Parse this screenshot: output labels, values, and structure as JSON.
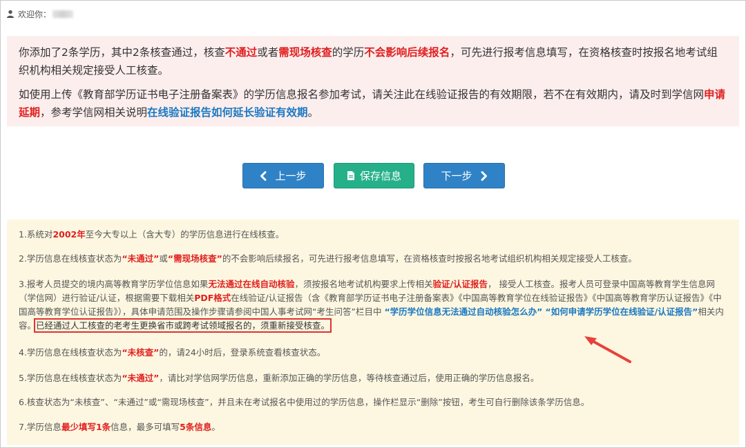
{
  "header": {
    "welcome_label": "欢迎你："
  },
  "notice": {
    "p1": {
      "s1": "你添加了2条学历，其中2条核查通过，核查",
      "s2": "不通过",
      "s3": "或者",
      "s4": "需现场核查",
      "s5": "的学历",
      "s6": "不会影响后续报名",
      "s7": "，可先进行报考信息填写，在资格核查时按报名地考试组织机构相关规定接受人工核查。"
    },
    "p2": {
      "s1": "如使用上传《教育部学历证书电子注册备案表》的学历信息报名参加考试，请关注此在线验证报告的有效期限，若不在有效期内，请及时到学信网",
      "s2": "申请延期",
      "s3": "，参考学信网相关说明",
      "s4": "在线验证报告如何延长验证有效期",
      "s5": "。"
    }
  },
  "buttons": {
    "prev_label": "上一步",
    "save_label": "保存信息",
    "next_label": "下一步"
  },
  "tips": {
    "t1": {
      "s1": "1.系统对",
      "s2": "2002年",
      "s3": "至今大专以上（含大专）的学历信息进行在线核查。"
    },
    "t2": {
      "s1": "2.学历信息在线核查状态为",
      "s2": "“未通过”",
      "s3": "或",
      "s4": "“需现场核查”",
      "s5": "的不会影响后续报名，可先进行报考信息填写，在资格核查时按报名地考试组织机构相关规定接受人工核查。"
    },
    "t3": {
      "s1": "3.报考人员提交的境内高等教育学历学位信息如果",
      "s2": "无法通过在线自动核验",
      "s3": "，须按报名地考试机构要求上传相关",
      "s4": "验证/认证报告",
      "s5": "，  接受人工核查。报考人员可登录中国高等教育学生信息网（学信网）进行验证/认证，根据需要下载相关",
      "s6": "PDF格式",
      "s7": "在线验证/认证报告（含《教育部学历证书电子注册备案表》《中国高等教育学位在线验证报告》《中国高等教育学历认证报告》《中国高等教育学位认证报告》），具体申请范围及操作步骤请参阅中国人事考试网“考生问答”栏目中 ",
      "s8": "“学历学位信息无法通过自动核验怎么办”",
      "s9": " ",
      "s10": "“如何申请学历学位在线验证/认证报告”",
      "s11": "相关内容。",
      "s12": "已经通过人工核查的老考生更换省市或跨考试领域报名的，须重新接受核查。"
    },
    "t4": {
      "s1": "4.学历信息在线核查状态为",
      "s2": "“未核查”",
      "s3": "的，请24小时后，登录系统查看核查状态。"
    },
    "t5": {
      "s1": "5.学历信息在线核查状态为",
      "s2": "“未通过”",
      "s3": "，请比对学信网学历信息，重新添加正确的学历信息，等待核查通过后，使用正确的学历信息报名。"
    },
    "t6": {
      "s1": "6.核查状态为“未核查”、“未通过”或“需现场核查”，并且未在考试报名中使用过的学历信息，操作栏显示“删除”按钮，考生可自行删除该条学历信息。"
    },
    "t7": {
      "s1": "7.学历信息",
      "s2": "最少填写1条",
      "s3": "信息，最多可填写",
      "s4": "5条信息",
      "s5": "。"
    }
  },
  "colors": {
    "notice_bg": "#fdeeee",
    "tips_bg": "#fdf7e1",
    "emphasis_red": "#e02020",
    "link_blue": "#1a78c2",
    "primary_button": "#2f82c6",
    "save_button": "#25b08a"
  },
  "icons": {
    "user": "user-icon",
    "prev": "chevron-left-icon",
    "save": "document-icon",
    "next": "chevron-right-icon",
    "annotation": "red-arrow-icon"
  }
}
